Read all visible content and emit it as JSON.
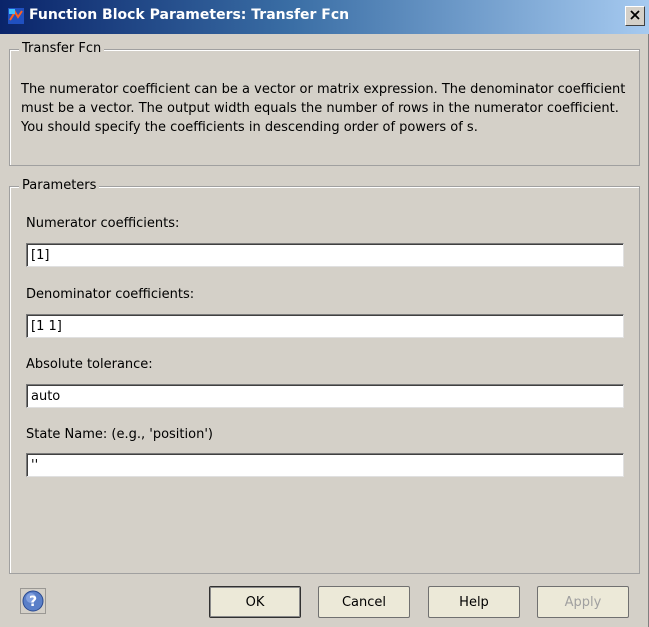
{
  "window": {
    "title": "Function Block Parameters: Transfer Fcn"
  },
  "description_group": {
    "legend": "Transfer Fcn",
    "text": "The numerator coefficient can be a vector or matrix expression. The denominator coefficient must be a vector. The output width equals the number of rows in the numerator coefficient. You should specify the coefficients in descending order of powers of s."
  },
  "parameters_group": {
    "legend": "Parameters",
    "fields": [
      {
        "label": "Numerator coefficients:",
        "value": "[1]"
      },
      {
        "label": "Denominator coefficients:",
        "value": "[1 1]"
      },
      {
        "label": "Absolute tolerance:",
        "value": "auto"
      },
      {
        "label": "State Name: (e.g., 'position')",
        "value": "''"
      }
    ]
  },
  "buttons": {
    "ok": "OK",
    "cancel": "Cancel",
    "help": "Help",
    "apply": "Apply"
  },
  "icons": {
    "app": "simulink-block-icon",
    "close": "close-icon",
    "help": "help-question-icon"
  },
  "colors": {
    "titlebar_start": "#0a246a",
    "titlebar_end": "#a6caf0",
    "dialog_bg": "#d4d0c8"
  }
}
